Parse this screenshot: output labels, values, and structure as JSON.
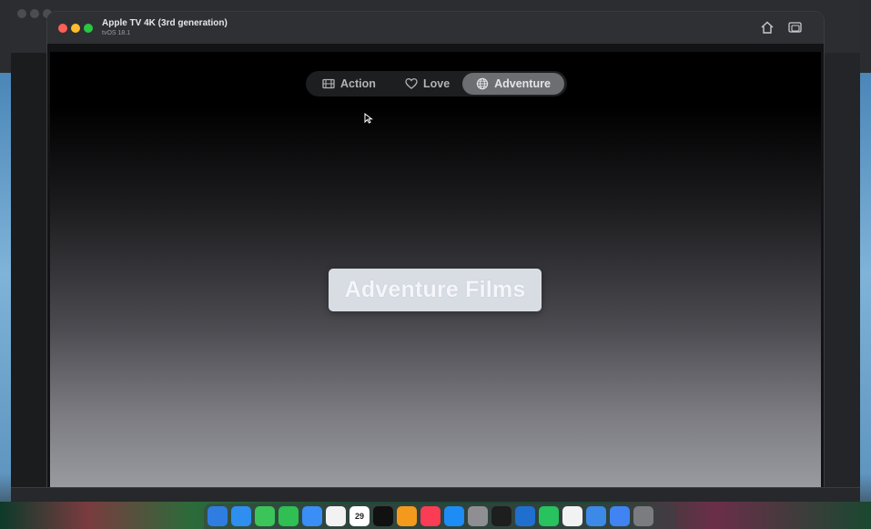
{
  "simulator": {
    "title": "Apple TV 4K (3rd generation)",
    "subtitle": "tvOS 18.1"
  },
  "app": {
    "tabs": [
      {
        "label": "Action",
        "icon": "film-icon",
        "selected": false
      },
      {
        "label": "Love",
        "icon": "heart-icon",
        "selected": false
      },
      {
        "label": "Adventure",
        "icon": "globe-icon",
        "selected": true
      }
    ],
    "content_title": "Adventure Films"
  },
  "dock": {
    "calendar_day": "29",
    "icons": [
      "finder-icon",
      "safari-icon",
      "messages-icon",
      "facetime-icon",
      "mail-icon",
      "photos-icon",
      "calendar-icon",
      "appletv-icon",
      "pages-icon",
      "music-icon",
      "appstore-icon",
      "settings-icon",
      "figma-icon",
      "outlook-icon",
      "whatsapp-icon",
      "chrome-icon",
      "pen-icon",
      "xcode-icon",
      "trash-icon"
    ],
    "colors": [
      "#2f7de1",
      "#2e8ff0",
      "#3bc45a",
      "#2fbf52",
      "#3a8ef5",
      "#f2f2f2",
      "#ffffff",
      "#111111",
      "#f39a1d",
      "#fa3c55",
      "#1d8cf5",
      "#8e8e93",
      "#1e1e1e",
      "#1f6fd1",
      "#28c25e",
      "#f2f2f2",
      "#3c89e8",
      "#3f84f2",
      "#7a7c80"
    ]
  },
  "colors": {
    "accent_selected_tab": "#6d6e72",
    "card": "#d8dce3"
  }
}
